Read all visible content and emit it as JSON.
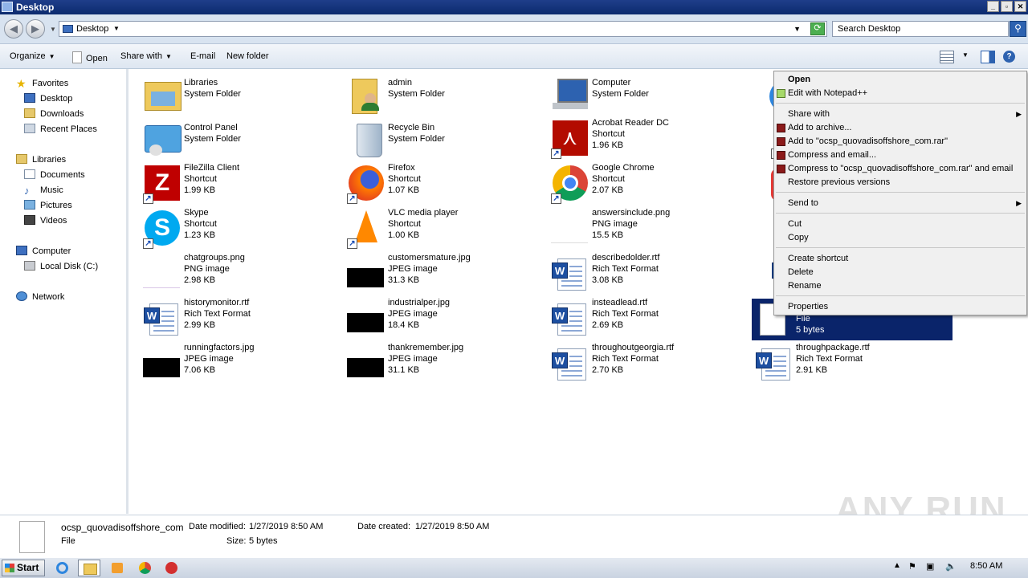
{
  "window": {
    "title": "Desktop",
    "buttons": [
      "_",
      "▫",
      "✕"
    ]
  },
  "address": {
    "location": "Desktop",
    "search_placeholder": "Search Desktop"
  },
  "toolbar": {
    "organize": "Organize",
    "open": "Open",
    "share_with": "Share with",
    "email": "E-mail",
    "new_folder": "New folder"
  },
  "nav": {
    "favorites": "Favorites",
    "desktop": "Desktop",
    "downloads": "Downloads",
    "recent": "Recent Places",
    "libraries": "Libraries",
    "documents": "Documents",
    "music": "Music",
    "pictures": "Pictures",
    "videos": "Videos",
    "computer": "Computer",
    "local_disk": "Local Disk (C:)",
    "network": "Network"
  },
  "files": [
    {
      "name": "Libraries",
      "type": "System Folder",
      "size": ""
    },
    {
      "name": "admin",
      "type": "System Folder",
      "size": ""
    },
    {
      "name": "Computer",
      "type": "System Folder",
      "size": ""
    },
    {
      "name": "Control Panel",
      "type": "System Folder",
      "size": ""
    },
    {
      "name": "Recycle Bin",
      "type": "System Folder",
      "size": ""
    },
    {
      "name": "Acrobat Reader DC",
      "type": "Shortcut",
      "size": "1.96 KB"
    },
    {
      "name": "FileZilla Client",
      "type": "Shortcut",
      "size": "1.99 KB"
    },
    {
      "name": "Firefox",
      "type": "Shortcut",
      "size": "1.07 KB"
    },
    {
      "name": "Google Chrome",
      "type": "Shortcut",
      "size": "2.07 KB"
    },
    {
      "name": "Skype",
      "type": "Shortcut",
      "size": "1.23 KB"
    },
    {
      "name": "VLC media player",
      "type": "Shortcut",
      "size": "1.00 KB"
    },
    {
      "name": "answersinclude.png",
      "type": "PNG image",
      "size": "15.5 KB"
    },
    {
      "name": "chatgroups.png",
      "type": "PNG image",
      "size": "2.98 KB"
    },
    {
      "name": "customersmature.jpg",
      "type": "JPEG image",
      "size": "31.3 KB"
    },
    {
      "name": "describedolder.rtf",
      "type": "Rich Text Format",
      "size": "3.08 KB"
    },
    {
      "name": "historymonitor.rtf",
      "type": "Rich Text Format",
      "size": "2.99 KB"
    },
    {
      "name": "industrialper.jpg",
      "type": "JPEG image",
      "size": "18.4 KB"
    },
    {
      "name": "insteadlead.rtf",
      "type": "Rich Text Format",
      "size": "2.69 KB"
    },
    {
      "name": "runningfactors.jpg",
      "type": "JPEG image",
      "size": "7.06 KB"
    },
    {
      "name": "thankremember.jpg",
      "type": "JPEG image",
      "size": "31.1 KB"
    },
    {
      "name": "throughoutgeorgia.rtf",
      "type": "Rich Text Format",
      "size": "2.70 KB"
    },
    {
      "name": "throughpackage.rtf",
      "type": "Rich Text Format",
      "size": "2.91 KB"
    }
  ],
  "selected_file": {
    "type": "File",
    "size": "5 bytes"
  },
  "context_menu": {
    "open": "Open",
    "edit_notepad": "Edit with Notepad++",
    "share_with": "Share with",
    "add_archive": "Add to archive...",
    "add_to_rar": "Add to \"ocsp_quovadisoffshore_com.rar\"",
    "compress_email": "Compress and email...",
    "compress_rar_email": "Compress to \"ocsp_quovadisoffshore_com.rar\" and email",
    "restore": "Restore previous versions",
    "send_to": "Send to",
    "cut": "Cut",
    "copy": "Copy",
    "create_shortcut": "Create shortcut",
    "delete": "Delete",
    "rename": "Rename",
    "properties": "Properties"
  },
  "details": {
    "name": "ocsp_quovadisoffshore_com",
    "type": "File",
    "date_modified_label": "Date modified:",
    "date_modified": "1/27/2019 8:50 AM",
    "date_created_label": "Date created:",
    "date_created": "1/27/2019 8:50 AM",
    "size_label": "Size:",
    "size": "5 bytes"
  },
  "watermark": "ANY RUN",
  "taskbar": {
    "start": "Start",
    "clock": "8:50 AM"
  },
  "colors": {
    "selection": "#0a246a",
    "titlebar": "#0b2a6e",
    "menu_bg": "#f0f0f0"
  }
}
